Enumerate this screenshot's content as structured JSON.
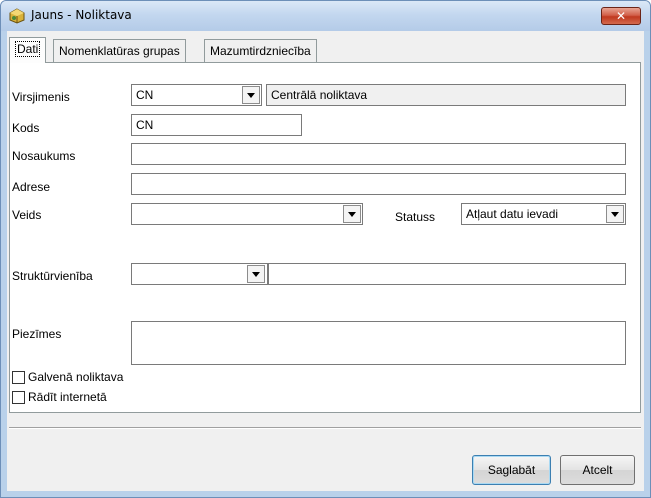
{
  "window": {
    "title": "Jauns - Noliktava",
    "close_label": "✕"
  },
  "tabs": [
    {
      "label": "Dati",
      "active": true
    },
    {
      "label": "Nomenklatūras grupas",
      "active": false
    },
    {
      "label": "Mazumtirdzniecība",
      "active": false
    }
  ],
  "form": {
    "virsjimenis": {
      "label": "Virsjimenis",
      "code": "CN",
      "name": "Centrālā noliktava"
    },
    "kods": {
      "label": "Kods",
      "value": "CN"
    },
    "nosaukums": {
      "label": "Nosaukums",
      "value": ""
    },
    "adrese": {
      "label": "Adrese",
      "value": ""
    },
    "veids": {
      "label": "Veids",
      "value": ""
    },
    "statuss": {
      "label": "Statuss",
      "value": "Atļaut datu ievadi"
    },
    "strukturvieniba": {
      "label": "Struktūrvienība",
      "code": "",
      "name": ""
    },
    "piezimes": {
      "label": "Piezīmes",
      "value": ""
    },
    "galvena": {
      "label": "Galvenā noliktava",
      "checked": false
    },
    "internets": {
      "label": "Rādīt internetā",
      "checked": false
    }
  },
  "buttons": {
    "save": "Saglabāt",
    "cancel": "Atcelt"
  }
}
